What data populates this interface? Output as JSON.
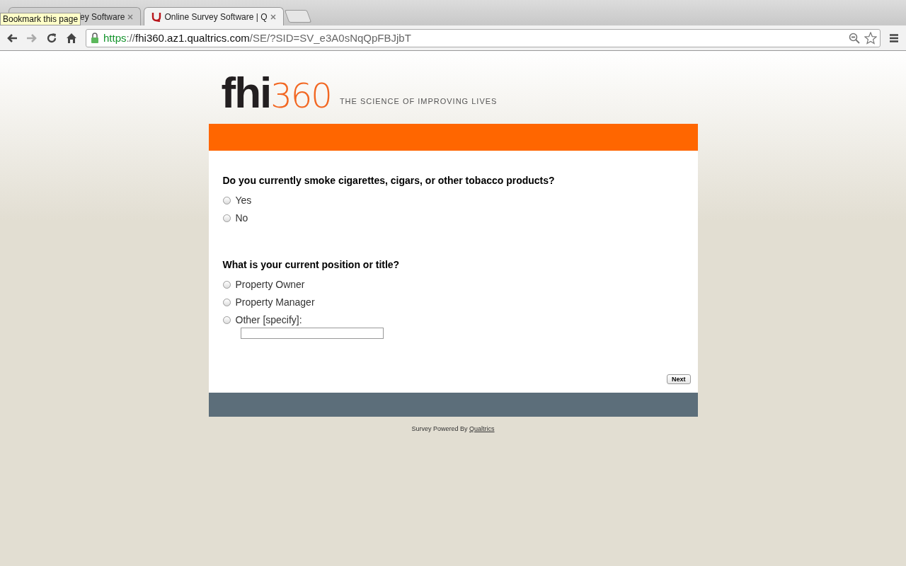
{
  "browser": {
    "tabs": [
      {
        "title": "ey Software",
        "selected": false
      },
      {
        "title": "Online Survey Software | Q",
        "selected": true
      }
    ],
    "tooltip": "Bookmark this page",
    "url": {
      "scheme": "https",
      "separator": "://",
      "host": "fhi360.az1.qualtrics.com",
      "path": "/SE/?SID=SV_e3A0sNqQpFBJjbT"
    }
  },
  "header": {
    "logo_main": "fhi",
    "logo_number": "360",
    "tagline": "THE SCIENCE OF IMPROVING LIVES"
  },
  "questions": [
    {
      "text": "Do you currently smoke cigarettes, cigars, or other tobacco products?",
      "choices": [
        {
          "label": "Yes",
          "selected": false
        },
        {
          "label": "No",
          "selected": false
        }
      ]
    },
    {
      "text": "What is your current position or title?",
      "choices": [
        {
          "label": "Property Owner",
          "selected": false
        },
        {
          "label": "Property Manager",
          "selected": false
        },
        {
          "label": "Other [specify]:",
          "selected": false,
          "kind": "text-entry"
        }
      ]
    }
  ],
  "next_button": "Next",
  "footer": {
    "text": "Survey Powered By",
    "link": "Qualtrics"
  }
}
